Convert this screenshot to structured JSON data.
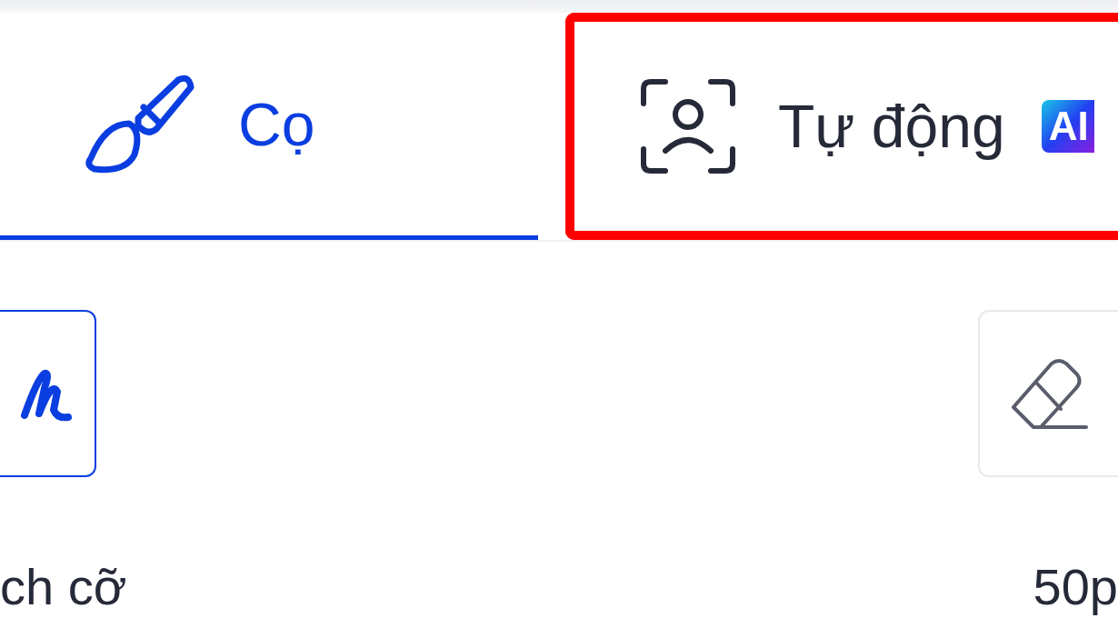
{
  "tabs": [
    {
      "kind": "brush",
      "label": "Cọ",
      "selected": true,
      "highlighted": false
    },
    {
      "kind": "auto",
      "label": "Tự động",
      "badge": "AI",
      "selected": false,
      "highlighted": true
    }
  ],
  "tools": [
    {
      "kind": "stroke",
      "selected": true
    },
    {
      "kind": "eraser",
      "selected": false
    }
  ],
  "size_label": "ch cỡ",
  "size_value": "50p"
}
